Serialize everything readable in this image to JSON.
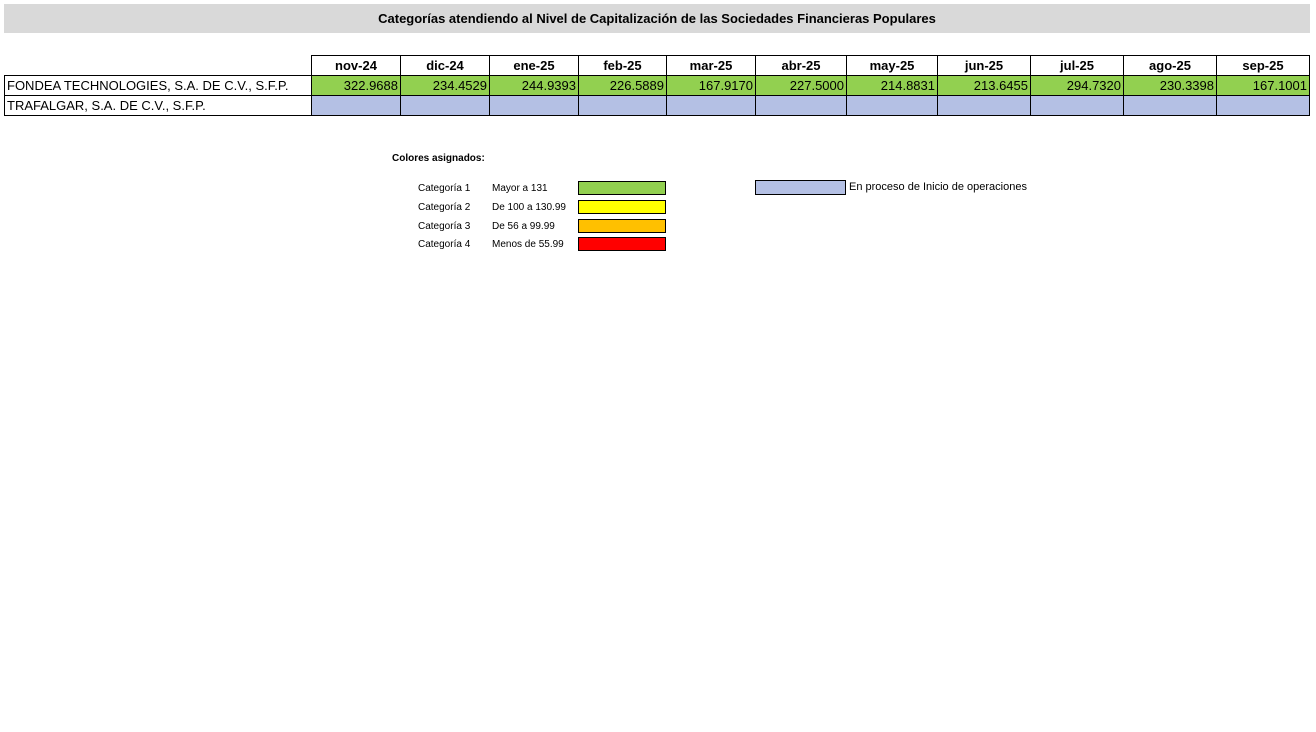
{
  "title": "Categorías atendiendo al Nivel de Capitalización de las Sociedades Financieras Populares",
  "months": [
    "nov-24",
    "dic-24",
    "ene-25",
    "feb-25",
    "mar-25",
    "abr-25",
    "may-25",
    "jun-25",
    "jul-25",
    "ago-25",
    "sep-25"
  ],
  "rows": [
    {
      "name": "FONDEA TECHNOLOGIES, S.A. DE C.V., S.F.P.",
      "values": [
        "322.9688",
        "234.4529",
        "244.9393",
        "226.5889",
        "167.9170",
        "227.5000",
        "214.8831",
        "213.6455",
        "294.7320",
        "230.3398",
        "167.1001"
      ],
      "color": "#92d050"
    },
    {
      "name": "TRAFALGAR, S.A. DE C.V., S.F.P.",
      "values": [
        "",
        "",
        "",
        "",
        "",
        "",
        "",
        "",
        "",
        "",
        ""
      ],
      "color": "#b4c0e4"
    }
  ],
  "legend": {
    "title": "Colores asignados:",
    "items": [
      {
        "category": "Categoría 1",
        "range": "Mayor a 131",
        "color": "#92d050"
      },
      {
        "category": "Categoría 2",
        "range": "De 100 a 130.99",
        "color": "#ffff00"
      },
      {
        "category": "Categoría 3",
        "range": "De 56 a 99.99",
        "color": "#ffc000"
      },
      {
        "category": "Categoría 4",
        "range": "Menos de 55.99",
        "color": "#ff0000"
      }
    ],
    "extra": {
      "label": "En proceso de Inicio de operaciones",
      "color": "#b4c0e4"
    }
  }
}
